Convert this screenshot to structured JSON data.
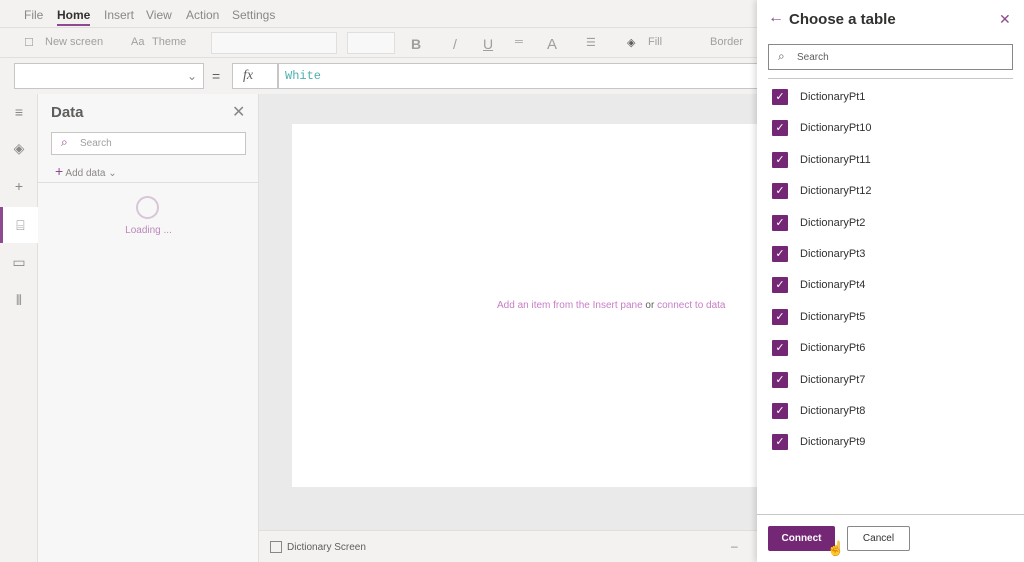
{
  "menu": [
    "File",
    "Home",
    "Insert",
    "View",
    "Action",
    "Settings"
  ],
  "toolbar": {
    "new_screen": "New screen",
    "theme": "Theme",
    "bold": "B",
    "italic": "/",
    "underline": "U",
    "font_color": "A",
    "fill": "Fill",
    "border": "Border"
  },
  "formula": {
    "value": "White",
    "fx": "fx"
  },
  "data_pane": {
    "title": "Data",
    "search_placeholder": "Search",
    "add_data": "Add data",
    "loading": "Loading ..."
  },
  "canvas": {
    "hint_part1": "Add an item from the Insert pane",
    "hint_or": "or",
    "hint_link": "connect to data"
  },
  "status": {
    "screen_name": "Dictionary Screen"
  },
  "panel": {
    "title": "Choose a table",
    "search_placeholder": "Search",
    "tables": [
      "DictionaryPt1",
      "DictionaryPt10",
      "DictionaryPt11",
      "DictionaryPt12",
      "DictionaryPt2",
      "DictionaryPt3",
      "DictionaryPt4",
      "DictionaryPt5",
      "DictionaryPt6",
      "DictionaryPt7",
      "DictionaryPt8",
      "DictionaryPt9"
    ],
    "connect": "Connect",
    "cancel": "Cancel"
  },
  "colors": {
    "accent": "#742774"
  }
}
